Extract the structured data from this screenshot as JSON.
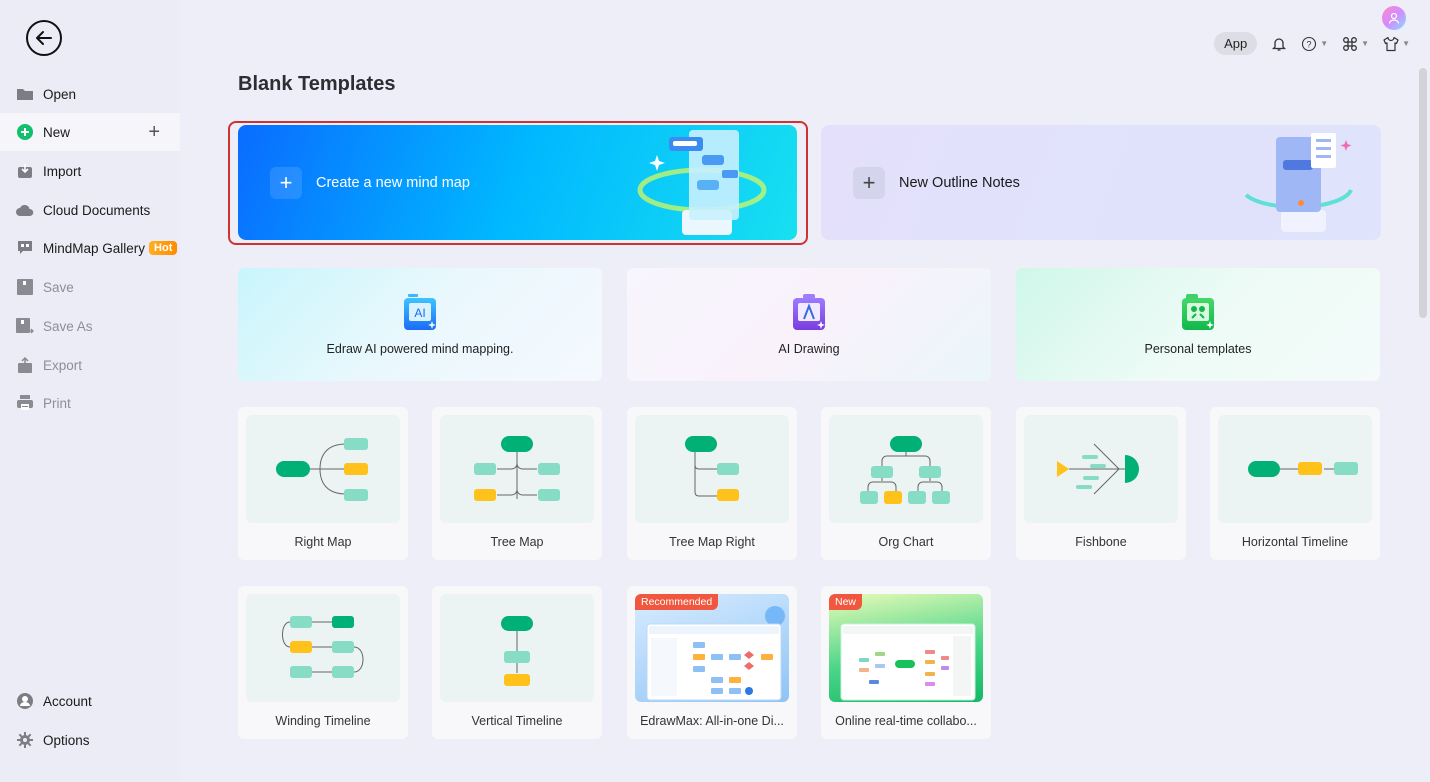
{
  "sidebar": {
    "back_label": "Back",
    "items": [
      {
        "label": "Open",
        "icon": "folder-icon"
      },
      {
        "label": "New",
        "icon": "plus-circle-icon"
      },
      {
        "label": "Import",
        "icon": "import-icon"
      },
      {
        "label": "Cloud Documents",
        "icon": "cloud-icon"
      },
      {
        "label": "MindMap Gallery",
        "icon": "gallery-icon",
        "badge": "Hot"
      },
      {
        "label": "Save",
        "icon": "save-icon"
      },
      {
        "label": "Save As",
        "icon": "save-as-icon"
      },
      {
        "label": "Export",
        "icon": "export-icon"
      },
      {
        "label": "Print",
        "icon": "print-icon"
      }
    ],
    "bottom": [
      {
        "label": "Account",
        "icon": "account-icon"
      },
      {
        "label": "Options",
        "icon": "gear-icon"
      }
    ]
  },
  "topbar": {
    "app_label": "App"
  },
  "main": {
    "title": "Blank Templates",
    "hero": [
      {
        "label": "Create a new mind map"
      },
      {
        "label": "New Outline Notes"
      }
    ],
    "features": [
      {
        "label": "Edraw AI powered mind mapping.",
        "icon_text": "AI"
      },
      {
        "label": "AI Drawing",
        "icon_text": "A"
      },
      {
        "label": "Personal templates"
      }
    ],
    "templates": [
      {
        "label": "Right Map"
      },
      {
        "label": "Tree Map"
      },
      {
        "label": "Tree Map Right"
      },
      {
        "label": "Org Chart"
      },
      {
        "label": "Fishbone"
      },
      {
        "label": "Horizontal Timeline"
      },
      {
        "label": "Winding Timeline"
      },
      {
        "label": "Vertical Timeline"
      },
      {
        "label": "EdrawMax: All-in-one Di...",
        "badge": "Recommended"
      },
      {
        "label": "Online real-time collabo...",
        "badge": "New"
      }
    ]
  },
  "colors": {
    "accent_green": "#00b074",
    "node_light": "#86dcc4",
    "node_yellow": "#ffc21a",
    "selection_red": "#d0332f",
    "hot_orange": "#ff9a00"
  }
}
